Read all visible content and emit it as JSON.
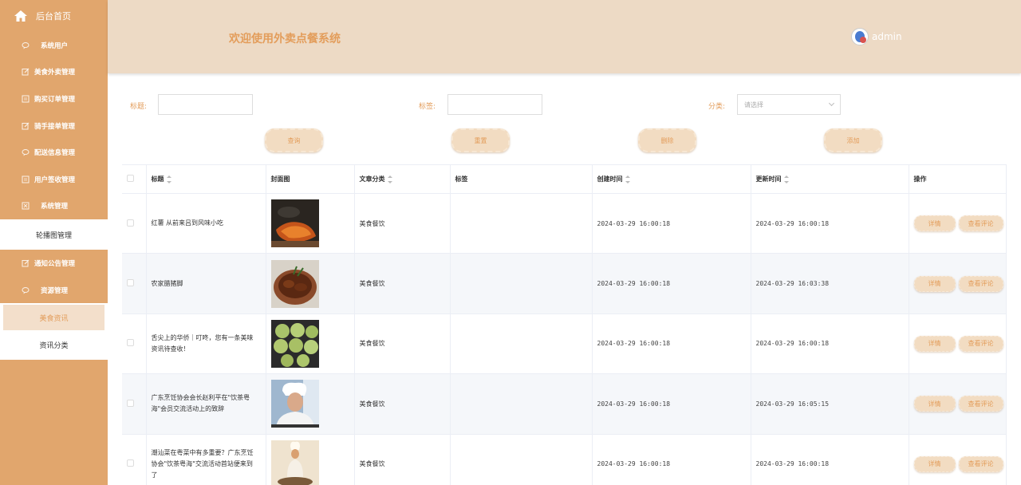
{
  "sidebar": {
    "home_label": "后台首页",
    "items": [
      {
        "label": "系统用户",
        "icon": "chat-bubble-icon"
      },
      {
        "label": "美食外卖管理",
        "icon": "edit-icon"
      },
      {
        "label": "购买订单管理",
        "icon": "document-icon"
      },
      {
        "label": "骑手接单管理",
        "icon": "edit-icon"
      },
      {
        "label": "配送信息管理",
        "icon": "chat-bubble-icon"
      },
      {
        "label": "用户签收管理",
        "icon": "document-icon"
      },
      {
        "label": "系统管理",
        "icon": "close-box-icon"
      }
    ],
    "system_sub": [
      "轮播图管理"
    ],
    "items2": [
      {
        "label": "通知公告管理",
        "icon": "edit-icon"
      },
      {
        "label": "资源管理",
        "icon": "chat-bubble-icon"
      }
    ],
    "resource_sub": [
      {
        "label": "美食资讯",
        "active": true
      },
      {
        "label": "资讯分类",
        "active": false
      }
    ]
  },
  "header": {
    "title": "欢迎使用外卖点餐系统",
    "username": "admin"
  },
  "search": {
    "title_label": "标题:",
    "tag_label": "标签:",
    "category_label": "分类:",
    "category_placeholder": "请选择"
  },
  "actions": {
    "query": "查询",
    "reset": "重置",
    "delete": "删除",
    "add": "添加"
  },
  "table": {
    "columns": {
      "title": "标题",
      "cover": "封面图",
      "category": "文章分类",
      "tag": "标签",
      "created": "创建时间",
      "updated": "更新时间",
      "ops": "操作"
    },
    "detail_label": "详情",
    "comment_label": "查看评论",
    "rows": [
      {
        "title": "红薯 从前来吕到风味小吃",
        "category": "美食餐饮",
        "tag": "",
        "created": "2024-03-29 16:00:18",
        "updated": "2024-03-29 16:00:18"
      },
      {
        "title": "农家腊猪脚",
        "category": "美食餐饮",
        "tag": "",
        "created": "2024-03-29 16:00:18",
        "updated": "2024-03-29 16:03:38"
      },
      {
        "title": "舌尖上的华侨｜叮咚，您有一条美味资讯待查收！",
        "category": "美食餐饮",
        "tag": "",
        "created": "2024-03-29 16:00:18",
        "updated": "2024-03-29 16:00:18"
      },
      {
        "title": "广东烹饪协会会长赵利平在\"饮茶粤海\"会员交流活动上的致辞",
        "category": "美食餐饮",
        "tag": "",
        "created": "2024-03-29 16:00:18",
        "updated": "2024-03-29 16:05:15"
      },
      {
        "title": "潮汕菜在粤菜中有多重要？广东烹饪协会\"饮茶粤海\"交流活动首站便来到了",
        "category": "美食餐饮",
        "tag": "",
        "created": "2024-03-29 16:00:18",
        "updated": "2024-03-29 16:00:18"
      }
    ]
  },
  "colors": {
    "sidebar": "#e1a66d",
    "header": "#eddac5",
    "accent": "#e39d5b"
  }
}
